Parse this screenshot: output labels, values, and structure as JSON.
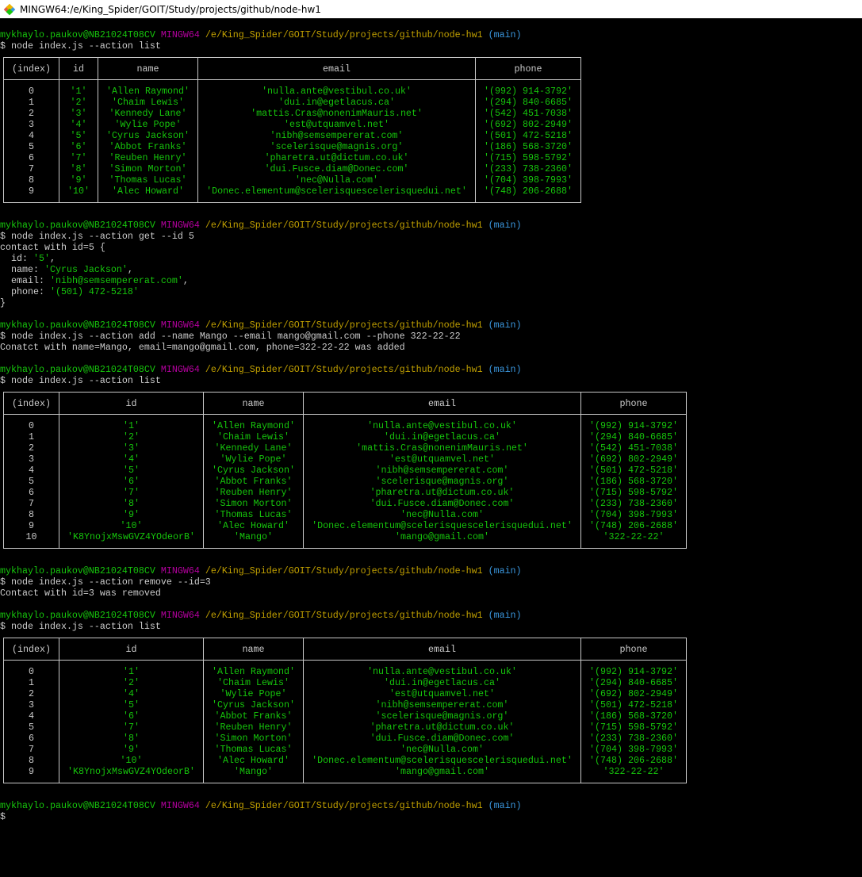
{
  "window": {
    "title": "MINGW64:/e/King_Spider/GOIT/Study/projects/github/node-hw1"
  },
  "colors": {
    "user": "#16c60c",
    "host": "#b4009e",
    "path": "#c1a000",
    "branch": "#3a96dd",
    "value": "#16c60c",
    "text": "#cccccc",
    "background": "#000000"
  },
  "prompt": {
    "user": "mykhaylo.paukov@NB21024T08CV",
    "host": "MINGW64",
    "path": "/e/King_Spider/GOIT/Study/projects/github/node-hw1",
    "branch": "(main)"
  },
  "table_headers": [
    "(index)",
    "id",
    "name",
    "email",
    "phone"
  ],
  "blocks": [
    {
      "type": "prompt"
    },
    {
      "type": "line",
      "segments": [
        [
          "$ node index.js --action list"
        ]
      ]
    },
    {
      "type": "table",
      "widths": [
        70,
        49,
        126,
        350,
        133
      ],
      "rows": [
        [
          "0",
          "'1'",
          "'Allen Raymond'",
          "'nulla.ante@vestibul.co.uk'",
          "'(992) 914-3792'"
        ],
        [
          "1",
          "'2'",
          "'Chaim Lewis'",
          "'dui.in@egetlacus.ca'",
          "'(294) 840-6685'"
        ],
        [
          "2",
          "'3'",
          "'Kennedy Lane'",
          "'mattis.Cras@nonenimMauris.net'",
          "'(542) 451-7038'"
        ],
        [
          "3",
          "'4'",
          "'Wylie Pope'",
          "'est@utquamvel.net'",
          "'(692) 802-2949'"
        ],
        [
          "4",
          "'5'",
          "'Cyrus Jackson'",
          "'nibh@semsempererat.com'",
          "'(501) 472-5218'"
        ],
        [
          "5",
          "'6'",
          "'Abbot Franks'",
          "'scelerisque@magnis.org'",
          "'(186) 568-3720'"
        ],
        [
          "6",
          "'7'",
          "'Reuben Henry'",
          "'pharetra.ut@dictum.co.uk'",
          "'(715) 598-5792'"
        ],
        [
          "7",
          "'8'",
          "'Simon Morton'",
          "'dui.Fusce.diam@Donec.com'",
          "'(233) 738-2360'"
        ],
        [
          "8",
          "'9'",
          "'Thomas Lucas'",
          "'nec@Nulla.com'",
          "'(704) 398-7993'"
        ],
        [
          "9",
          "'10'",
          "'Alec Howard'",
          "'Donec.elementum@scelerisquescelerisquedui.net'",
          "'(748) 206-2688'"
        ]
      ]
    },
    {
      "type": "line",
      "segments": [
        [
          ""
        ]
      ]
    },
    {
      "type": "prompt"
    },
    {
      "type": "line",
      "segments": [
        [
          "$ node index.js --action get --id 5"
        ]
      ]
    },
    {
      "type": "line",
      "segments": [
        [
          "contact with id=5 {"
        ]
      ]
    },
    {
      "type": "line",
      "segments": [
        [
          "  id: "
        ],
        [
          "'5'",
          "g"
        ],
        [
          ","
        ]
      ]
    },
    {
      "type": "line",
      "segments": [
        [
          "  name: "
        ],
        [
          "'Cyrus Jackson'",
          "g"
        ],
        [
          ","
        ]
      ]
    },
    {
      "type": "line",
      "segments": [
        [
          "  email: "
        ],
        [
          "'nibh@semsempererat.com'",
          "g"
        ],
        [
          ","
        ]
      ]
    },
    {
      "type": "line",
      "segments": [
        [
          "  phone: "
        ],
        [
          "'(501) 472-5218'",
          "g"
        ]
      ]
    },
    {
      "type": "line",
      "segments": [
        [
          "}"
        ]
      ]
    },
    {
      "type": "line",
      "segments": [
        [
          ""
        ]
      ]
    },
    {
      "type": "prompt"
    },
    {
      "type": "line",
      "segments": [
        [
          "$ node index.js --action add --name Mango --email mango@gmail.com --phone 322-22-22"
        ]
      ]
    },
    {
      "type": "line",
      "segments": [
        [
          "Conatct with name=Mango, email=mango@gmail.com, phone=322-22-22 was added"
        ]
      ]
    },
    {
      "type": "line",
      "segments": [
        [
          ""
        ]
      ]
    },
    {
      "type": "prompt"
    },
    {
      "type": "line",
      "segments": [
        [
          "$ node index.js --action list"
        ]
      ]
    },
    {
      "type": "table",
      "widths": [
        70,
        182,
        126,
        350,
        133
      ],
      "rows": [
        [
          "0",
          "'1'",
          "'Allen Raymond'",
          "'nulla.ante@vestibul.co.uk'",
          "'(992) 914-3792'"
        ],
        [
          "1",
          "'2'",
          "'Chaim Lewis'",
          "'dui.in@egetlacus.ca'",
          "'(294) 840-6685'"
        ],
        [
          "2",
          "'3'",
          "'Kennedy Lane'",
          "'mattis.Cras@nonenimMauris.net'",
          "'(542) 451-7038'"
        ],
        [
          "3",
          "'4'",
          "'Wylie Pope'",
          "'est@utquamvel.net'",
          "'(692) 802-2949'"
        ],
        [
          "4",
          "'5'",
          "'Cyrus Jackson'",
          "'nibh@semsempererat.com'",
          "'(501) 472-5218'"
        ],
        [
          "5",
          "'6'",
          "'Abbot Franks'",
          "'scelerisque@magnis.org'",
          "'(186) 568-3720'"
        ],
        [
          "6",
          "'7'",
          "'Reuben Henry'",
          "'pharetra.ut@dictum.co.uk'",
          "'(715) 598-5792'"
        ],
        [
          "7",
          "'8'",
          "'Simon Morton'",
          "'dui.Fusce.diam@Donec.com'",
          "'(233) 738-2360'"
        ],
        [
          "8",
          "'9'",
          "'Thomas Lucas'",
          "'nec@Nulla.com'",
          "'(704) 398-7993'"
        ],
        [
          "9",
          "'10'",
          "'Alec Howard'",
          "'Donec.elementum@scelerisquescelerisquedui.net'",
          "'(748) 206-2688'"
        ],
        [
          "10",
          "'K8YnojxMswGVZ4YOdeorB'",
          "'Mango'",
          "'mango@gmail.com'",
          "'322-22-22'"
        ]
      ]
    },
    {
      "type": "line",
      "segments": [
        [
          ""
        ]
      ]
    },
    {
      "type": "prompt"
    },
    {
      "type": "line",
      "segments": [
        [
          "$ node index.js --action remove --id=3"
        ]
      ]
    },
    {
      "type": "line",
      "segments": [
        [
          "Contact with id=3 was removed"
        ]
      ]
    },
    {
      "type": "line",
      "segments": [
        [
          ""
        ]
      ]
    },
    {
      "type": "prompt"
    },
    {
      "type": "line",
      "segments": [
        [
          "$ node index.js --action list"
        ]
      ]
    },
    {
      "type": "table",
      "widths": [
        70,
        182,
        126,
        350,
        133
      ],
      "rows": [
        [
          "0",
          "'1'",
          "'Allen Raymond'",
          "'nulla.ante@vestibul.co.uk'",
          "'(992) 914-3792'"
        ],
        [
          "1",
          "'2'",
          "'Chaim Lewis'",
          "'dui.in@egetlacus.ca'",
          "'(294) 840-6685'"
        ],
        [
          "2",
          "'4'",
          "'Wylie Pope'",
          "'est@utquamvel.net'",
          "'(692) 802-2949'"
        ],
        [
          "3",
          "'5'",
          "'Cyrus Jackson'",
          "'nibh@semsempererat.com'",
          "'(501) 472-5218'"
        ],
        [
          "4",
          "'6'",
          "'Abbot Franks'",
          "'scelerisque@magnis.org'",
          "'(186) 568-3720'"
        ],
        [
          "5",
          "'7'",
          "'Reuben Henry'",
          "'pharetra.ut@dictum.co.uk'",
          "'(715) 598-5792'"
        ],
        [
          "6",
          "'8'",
          "'Simon Morton'",
          "'dui.Fusce.diam@Donec.com'",
          "'(233) 738-2360'"
        ],
        [
          "7",
          "'9'",
          "'Thomas Lucas'",
          "'nec@Nulla.com'",
          "'(704) 398-7993'"
        ],
        [
          "8",
          "'10'",
          "'Alec Howard'",
          "'Donec.elementum@scelerisquescelerisquedui.net'",
          "'(748) 206-2688'"
        ],
        [
          "9",
          "'K8YnojxMswGVZ4YOdeorB'",
          "'Mango'",
          "'mango@gmail.com'",
          "'322-22-22'"
        ]
      ]
    },
    {
      "type": "line",
      "segments": [
        [
          ""
        ]
      ]
    },
    {
      "type": "prompt"
    },
    {
      "type": "line",
      "segments": [
        [
          "$ "
        ]
      ]
    }
  ]
}
